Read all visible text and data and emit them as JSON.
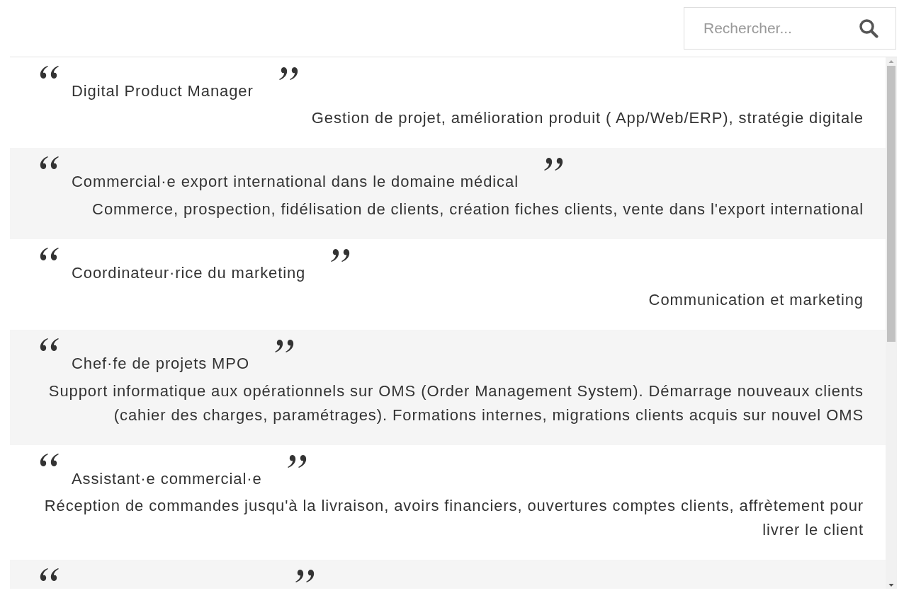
{
  "search": {
    "placeholder": "Rechercher..."
  },
  "items": [
    {
      "title": "Digital Product Manager",
      "description": "Gestion de projet, amélioration produit ( App/Web/ERP), stratégie digitale"
    },
    {
      "title": "Commercial·e export international dans le domaine médical",
      "description": "Commerce, prospection, fidélisation de clients, création fiches clients, vente dans l'export international"
    },
    {
      "title": "Coordinateur·rice du marketing",
      "description": "Communication et marketing"
    },
    {
      "title": "Chef·fe de projets MPO",
      "description": "Support informatique aux opérationnels sur OMS (Order Management System). Démarrage nouveaux clients (cahier des charges, paramétrages). Formations internes, migrations clients acquis sur nouvel OMS"
    },
    {
      "title": "Assistant·e commercial·e",
      "description": "Réception de commandes jusqu'à la livraison, avoirs financiers, ouvertures comptes clients, affrètement pour livrer le client"
    }
  ],
  "partial_row": true
}
